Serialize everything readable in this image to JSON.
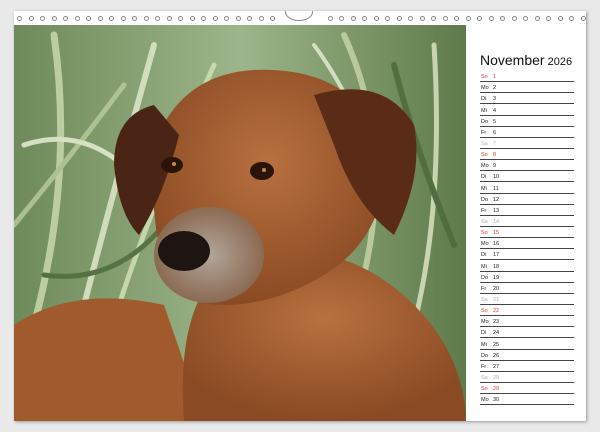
{
  "calendar": {
    "month": "November",
    "year": "2026",
    "days": [
      {
        "wd": "So",
        "d": "1",
        "type": "sun"
      },
      {
        "wd": "Mo",
        "d": "2",
        "type": "week"
      },
      {
        "wd": "Di",
        "d": "3",
        "type": "week"
      },
      {
        "wd": "Mi",
        "d": "4",
        "type": "week"
      },
      {
        "wd": "Do",
        "d": "5",
        "type": "week"
      },
      {
        "wd": "Fr",
        "d": "6",
        "type": "week"
      },
      {
        "wd": "Sa",
        "d": "7",
        "type": "sat"
      },
      {
        "wd": "So",
        "d": "8",
        "type": "sun"
      },
      {
        "wd": "Mo",
        "d": "9",
        "type": "week"
      },
      {
        "wd": "Di",
        "d": "10",
        "type": "week"
      },
      {
        "wd": "Mi",
        "d": "11",
        "type": "week"
      },
      {
        "wd": "Do",
        "d": "12",
        "type": "week"
      },
      {
        "wd": "Fr",
        "d": "13",
        "type": "week"
      },
      {
        "wd": "Sa",
        "d": "14",
        "type": "sat"
      },
      {
        "wd": "So",
        "d": "15",
        "type": "sun"
      },
      {
        "wd": "Mo",
        "d": "16",
        "type": "week"
      },
      {
        "wd": "Di",
        "d": "17",
        "type": "week"
      },
      {
        "wd": "Mi",
        "d": "18",
        "type": "week"
      },
      {
        "wd": "Do",
        "d": "19",
        "type": "week"
      },
      {
        "wd": "Fr",
        "d": "20",
        "type": "week"
      },
      {
        "wd": "Sa",
        "d": "21",
        "type": "sat"
      },
      {
        "wd": "So",
        "d": "22",
        "type": "sun"
      },
      {
        "wd": "Mo",
        "d": "23",
        "type": "week"
      },
      {
        "wd": "Di",
        "d": "24",
        "type": "week"
      },
      {
        "wd": "Mi",
        "d": "25",
        "type": "week"
      },
      {
        "wd": "Do",
        "d": "26",
        "type": "week"
      },
      {
        "wd": "Fr",
        "d": "27",
        "type": "week"
      },
      {
        "wd": "Sa",
        "d": "28",
        "type": "sat"
      },
      {
        "wd": "So",
        "d": "29",
        "type": "sun"
      },
      {
        "wd": "Mo",
        "d": "30",
        "type": "week"
      }
    ]
  },
  "colors": {
    "sunday": "#d23c2c",
    "saturday": "#b0b0b0",
    "weekday": "#222222"
  }
}
